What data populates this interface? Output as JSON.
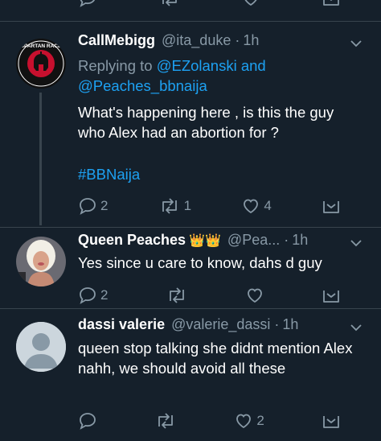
{
  "colors": {
    "background": "#15202b",
    "divider": "#38444d",
    "text_primary": "#ffffff",
    "text_secondary": "#8899a6",
    "link": "#1da1f2",
    "crown": "#f4c542"
  },
  "tweets": [
    {
      "name": "CallMebigg",
      "handle": "@ita_duke",
      "time": "1h",
      "replying_prefix": "Replying to",
      "replying_user_1": "@EZolanski",
      "replying_and": "and",
      "replying_user_2": "@Peaches_bbnaija",
      "text": "What's happening here , is this the guy who Alex had an abortion for ?",
      "hashtag": "#BBNaija",
      "reply_count": "2",
      "retweet_count": "1",
      "like_count": "4",
      "avatar_icon": "spartan-race-logo",
      "avatar_text": "SPARTAN RACE"
    },
    {
      "name": "Queen Peaches",
      "emoji": "👑👑",
      "handle": "@Pea...",
      "time": "1h",
      "text": "Yes since u care to know, dahs d guy",
      "reply_count": "2",
      "retweet_count": "",
      "like_count": "",
      "avatar_icon": "user-photo"
    },
    {
      "name": "dassi valerie",
      "handle": "@valerie_dassi",
      "time": "1h",
      "text": "queen stop talking she didnt mention Alex nahh, we should avoid all these",
      "reply_count": "",
      "retweet_count": "",
      "like_count": "2",
      "avatar_icon": "default-profile-icon"
    }
  ]
}
